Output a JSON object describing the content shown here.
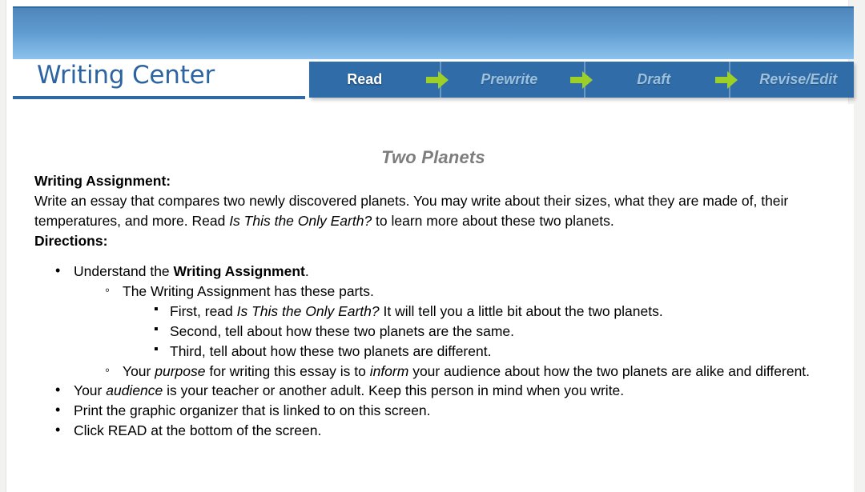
{
  "header": {
    "brand_title": "Writing Center",
    "nav_steps": [
      {
        "label": "Read",
        "active": true
      },
      {
        "label": "Prewrite",
        "active": false
      },
      {
        "label": "Draft",
        "active": false
      },
      {
        "label": "Revise/Edit",
        "active": false
      }
    ],
    "arrow_icon": "green-right-arrow",
    "colors": {
      "banner_top": "#3a78b4",
      "banner_bottom": "#8cc2ec",
      "nav_background": "#2f6ca8",
      "nav_active_text": "#ffffff",
      "nav_inactive_text": "#9dc0dd",
      "arrow_green": "#9ccf28",
      "brand_blue": "#2b64a0"
    }
  },
  "document": {
    "title": "Two Planets",
    "assignment_label": "Writing Assignment:",
    "assignment_text_1": "Write an essay that compares two newly discovered planets. You may write about their sizes, what they are made of, their temperatures, and more. Read ",
    "assignment_book_title": "Is This the Only Earth?",
    "assignment_text_2": " to learn more about these two planets.",
    "directions_label": "Directions:",
    "bullets": {
      "b1_pre": "Understand the ",
      "b1_bold": "Writing Assignment",
      "b1_post": ".",
      "b1_sub1": "The Writing Assignment has these parts.",
      "b1_sub1_items": {
        "i1_pre": "First, read ",
        "i1_italic": "Is This the Only Earth?",
        "i1_post": " It will tell you a little bit about the two planets.",
        "i2": "Second, tell about how these two planets are the same.",
        "i3": "Third, tell about how these two planets are different."
      },
      "b1_sub2_pre": "Your ",
      "b1_sub2_it1": "purpose",
      "b1_sub2_mid": " for writing this essay is to ",
      "b1_sub2_it2": "inform",
      "b1_sub2_post": " your audience about how the two planets are alike and different.",
      "b2_pre": "Your ",
      "b2_it": "audience",
      "b2_post": " is your teacher or another adult. Keep this person in mind when you write.",
      "b3": "Print the graphic organizer that is linked to on this screen.",
      "b4": "Click READ at the bottom of the screen."
    }
  }
}
